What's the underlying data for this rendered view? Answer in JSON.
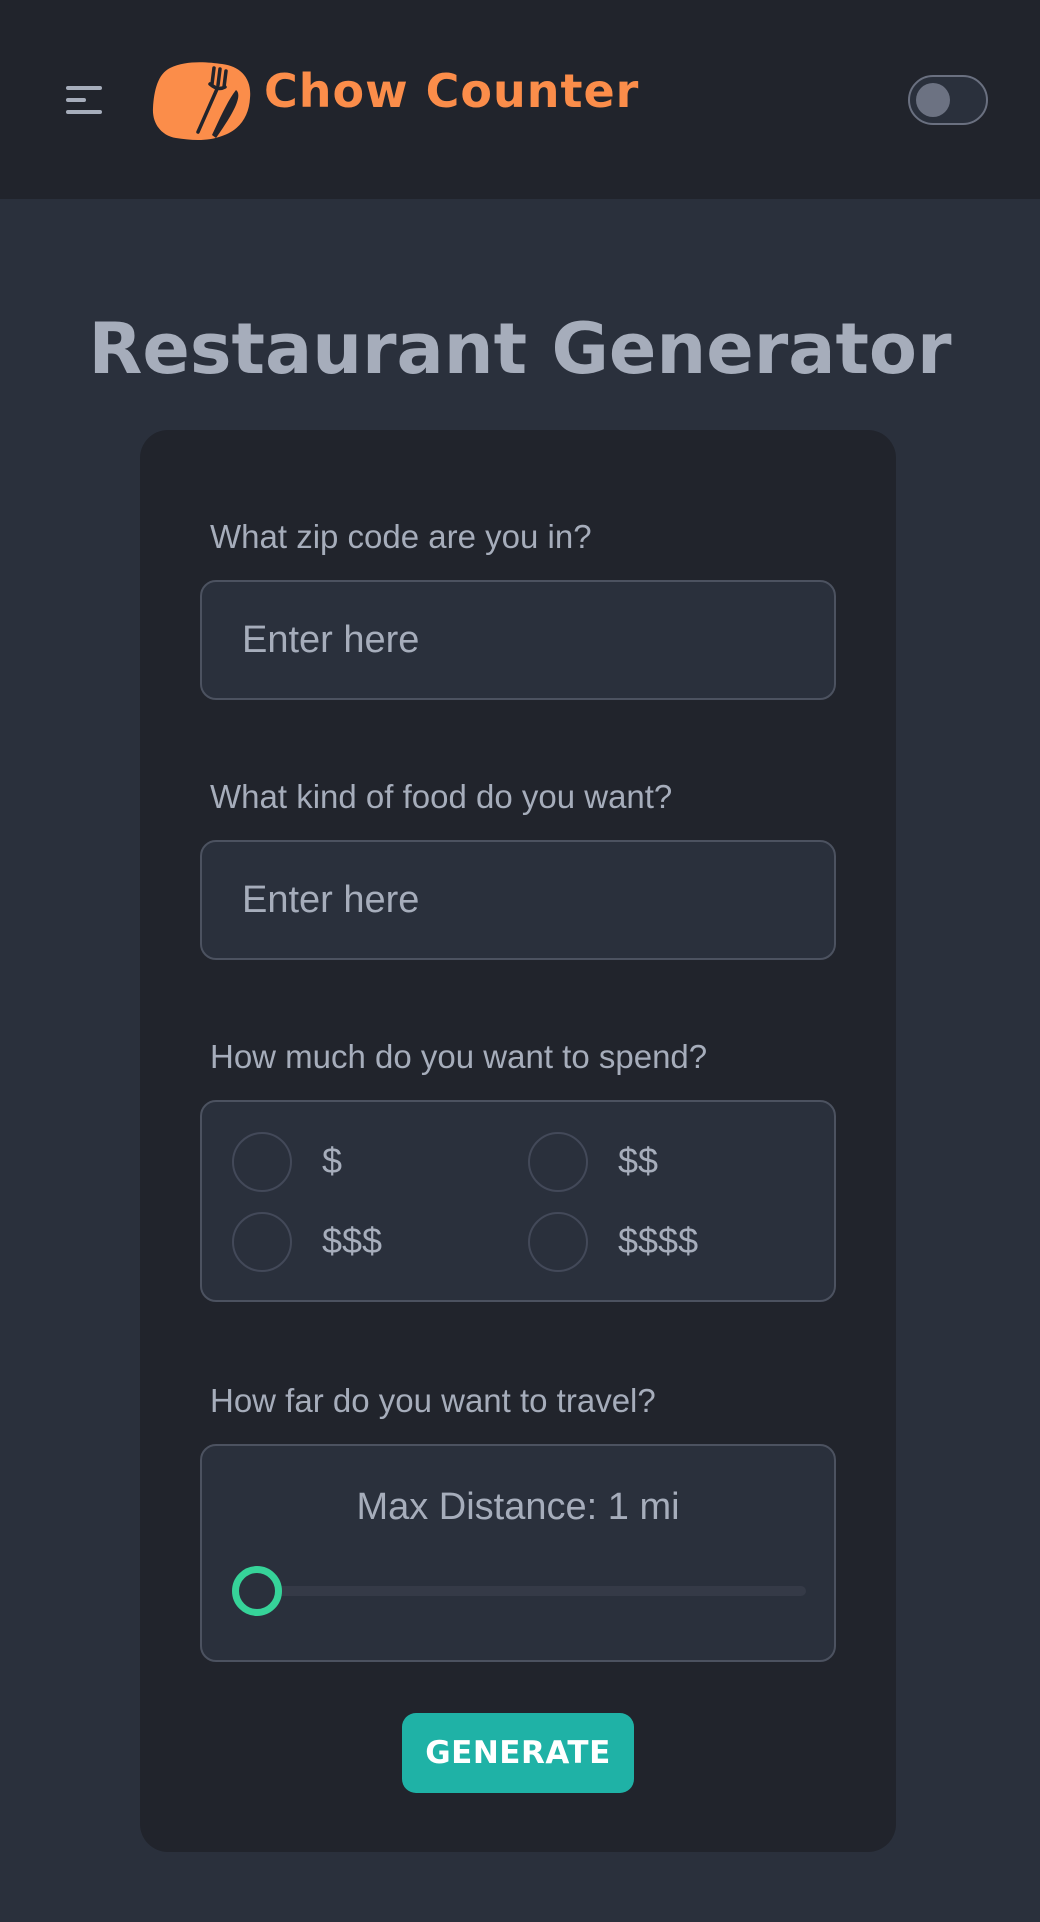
{
  "header": {
    "brand": "Chow Counter",
    "menu_icon": "hamburger-menu-icon",
    "logo_icon": "fork-knife-logo-icon",
    "theme_toggle_on": false
  },
  "page": {
    "title": "Restaurant Generator"
  },
  "form": {
    "zip": {
      "label": "What zip code are you in?",
      "placeholder": "Enter here",
      "value": ""
    },
    "food": {
      "label": "What kind of food do you want?",
      "placeholder": "Enter here",
      "value": ""
    },
    "price": {
      "label": "How much do you want to spend?",
      "options": [
        "$",
        "$$",
        "$$$",
        "$$$$"
      ],
      "selected": null
    },
    "distance": {
      "label": "How far do you want to travel?",
      "text": "Max Distance: 1 mi",
      "value_mi": 1,
      "slider_fraction": 0
    },
    "submit_label": "GENERATE"
  },
  "colors": {
    "brand": "#fb8d4a",
    "background": "#2a303c",
    "card": "#21242c",
    "text": "#a6adbb",
    "accent": "#1fb2a6",
    "slider": "#36d399"
  }
}
